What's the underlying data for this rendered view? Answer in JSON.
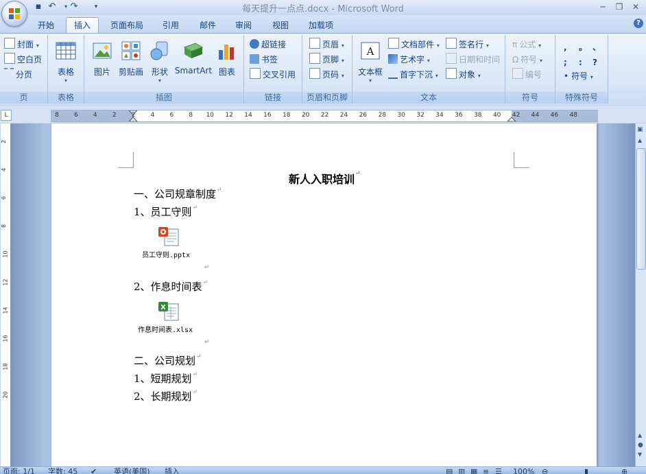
{
  "window": {
    "title": "每天提升一点点.docx - Microsoft Word"
  },
  "quick_access": {
    "save_icon": "save-icon",
    "undo_icon": "undo-icon",
    "redo_icon": "redo-icon",
    "customize_icon": "qat-customize-icon"
  },
  "tabs": [
    "开始",
    "插入",
    "页面布局",
    "引用",
    "邮件",
    "审阅",
    "视图",
    "加载项"
  ],
  "active_tab": "插入",
  "ribbon": {
    "pages": {
      "label": "页",
      "items": [
        "封面",
        "空白页",
        "分页"
      ]
    },
    "tables": {
      "label": "表格",
      "items": [
        "表格"
      ]
    },
    "illustrations": {
      "label": "插图",
      "items": [
        "图片",
        "剪贴画",
        "形状",
        "SmartArt",
        "图表"
      ]
    },
    "links": {
      "label": "链接",
      "items": [
        "超链接",
        "书签",
        "交叉引用"
      ]
    },
    "header_footer": {
      "label": "页眉和页脚",
      "items": [
        "页眉",
        "页脚",
        "页码"
      ]
    },
    "text": {
      "label": "文本",
      "big": "文本框",
      "items": [
        "文档部件",
        "艺术字",
        "首字下沉",
        "签名行",
        "日期和时间",
        "对象"
      ]
    },
    "symbols": {
      "label": "符号",
      "items": [
        "公式",
        "符号",
        "编号"
      ]
    },
    "special": {
      "label": "特殊符号",
      "row1": [
        ",",
        "。",
        "、"
      ],
      "row2": [
        ";",
        ":",
        "?"
      ],
      "more": "符号"
    }
  },
  "ruler": {
    "labels": [
      "8",
      "6",
      "4",
      "2",
      "2",
      "4",
      "6",
      "8",
      "10",
      "12",
      "14",
      "16",
      "18",
      "20",
      "22",
      "24",
      "26",
      "28",
      "30",
      "32",
      "34",
      "36",
      "38",
      "40",
      "42",
      "44",
      "46",
      "48"
    ]
  },
  "vruler": {
    "labels": [
      "2",
      "4",
      "6",
      "8",
      "10",
      "12",
      "14",
      "16",
      "18",
      "20"
    ]
  },
  "document": {
    "title": "新人入职培训",
    "section1": "一、公司规章制度",
    "item1": "1、员工守则",
    "attachment1": "员工守则.pptx",
    "item2": "2、作息时间表",
    "attachment2": "作息时间表.xlsx",
    "section2": "二、公司规划",
    "item3": "1、短期规划",
    "item4": "2、长期规划"
  },
  "status": {
    "page": "页面: 1/1",
    "words": "字数: 45",
    "language": "英语(美国)",
    "mode": "插入",
    "zoom": "100%"
  }
}
